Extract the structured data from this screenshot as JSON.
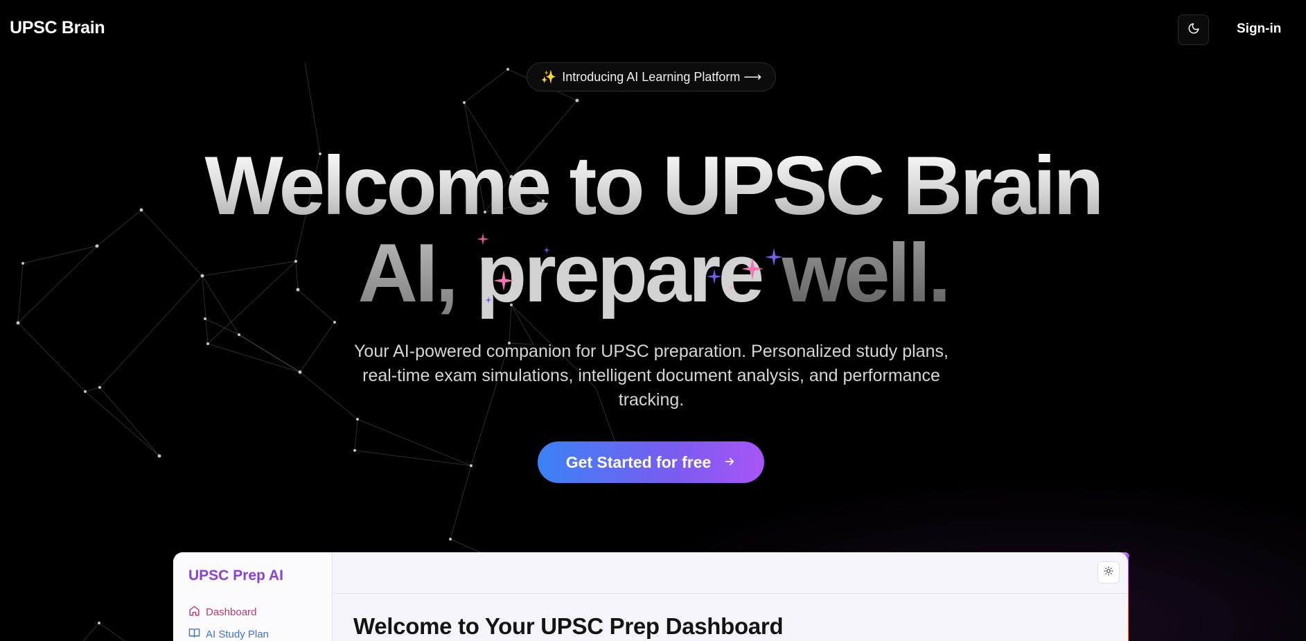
{
  "header": {
    "brand": "UPSC Brain",
    "theme_toggle_icon": "moon-icon",
    "signin_label": "Sign-in"
  },
  "intro_pill": {
    "emoji": "✨",
    "label": "Introducing AI Learning Platform ⟶"
  },
  "hero": {
    "line1": "Welcome to UPSC Brain",
    "line2_ai": "AI,",
    "line2_prepare": "prepare",
    "line2_well": "well.",
    "subtitle": "Your AI-powered companion for UPSC preparation. Personalized study plans, real-time exam simulations, intelligent document analysis, and performance tracking.",
    "cta_label": "Get Started for free",
    "cta_icon": "arrow-right-icon"
  },
  "preview": {
    "brand": "UPSC Prep AI",
    "nav": [
      {
        "label": "Dashboard",
        "icon": "home-icon"
      },
      {
        "label": "AI Study Plan",
        "icon": "book-icon"
      }
    ],
    "theme_icon": "sun-icon",
    "title": "Welcome to Your UPSC Prep Dashboard"
  },
  "colors": {
    "background": "#000000",
    "cta_start": "#3b82f6",
    "cta_end": "#a855f7",
    "preview_brand": "#8b3fd9",
    "nav_active": "#c2366b",
    "nav_link": "#3b6fd6",
    "sparkle_pink": "#f472b6",
    "sparkle_purple": "#7c5cf0"
  }
}
